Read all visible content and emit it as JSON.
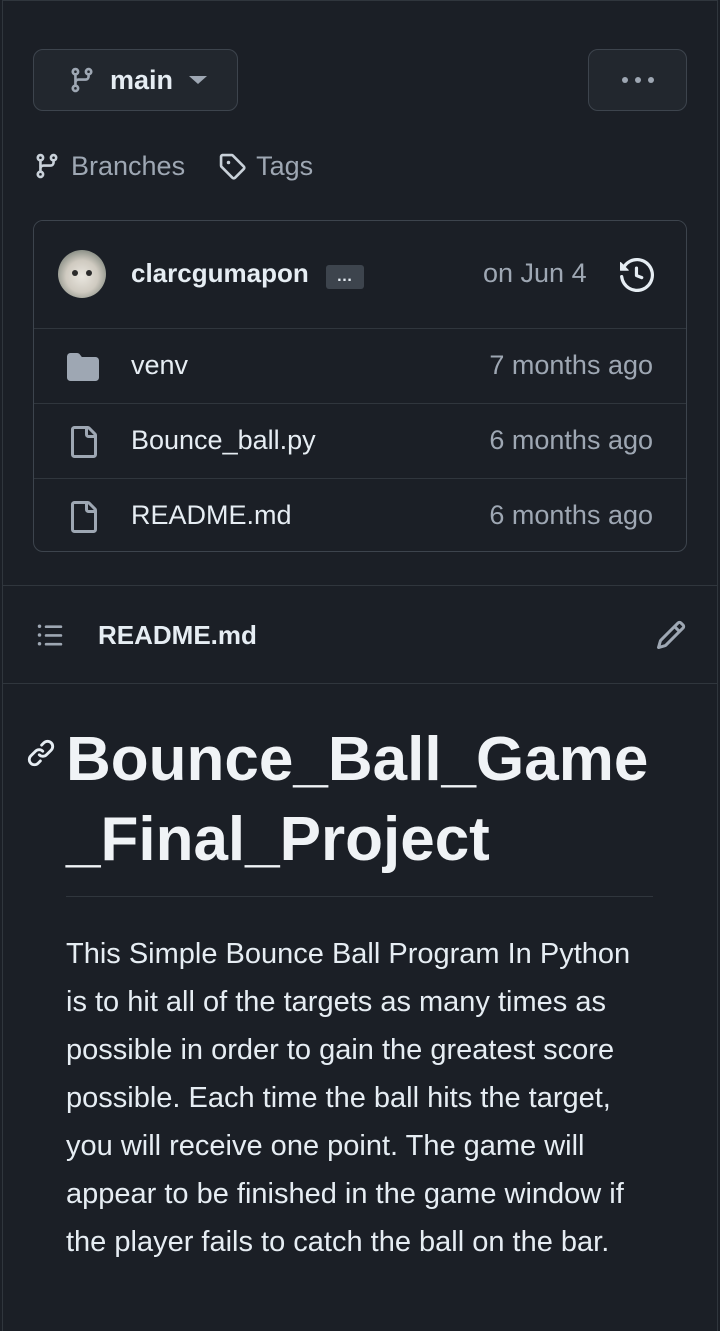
{
  "branch": {
    "label": "main"
  },
  "links": {
    "branches": "Branches",
    "tags": "Tags"
  },
  "commit": {
    "author": "clarcgumapon",
    "expand": "…",
    "date": "on Jun 4"
  },
  "files": [
    {
      "name": "venv",
      "type": "folder",
      "date": "7 months ago"
    },
    {
      "name": "Bounce_ball.py",
      "type": "file",
      "date": "6 months ago"
    },
    {
      "name": "README.md",
      "type": "file",
      "date": "6 months ago"
    }
  ],
  "readme": {
    "title": "README.md",
    "heading": "Bounce_Ball_Game_Final_Project",
    "paragraph": "This Simple Bounce Ball Program In Python is to hit all of the targets as many times as possible in order to gain the greatest score possible. Each time the ball hits the target, you will receive one point. The game will appear to be finished in the game window if the player fails to catch the ball on the bar."
  },
  "colors": {
    "background": "#1b1f26",
    "border": "#30363d",
    "text": "#e6edf3",
    "muted": "#9ea7b3",
    "button": "#22272e"
  }
}
